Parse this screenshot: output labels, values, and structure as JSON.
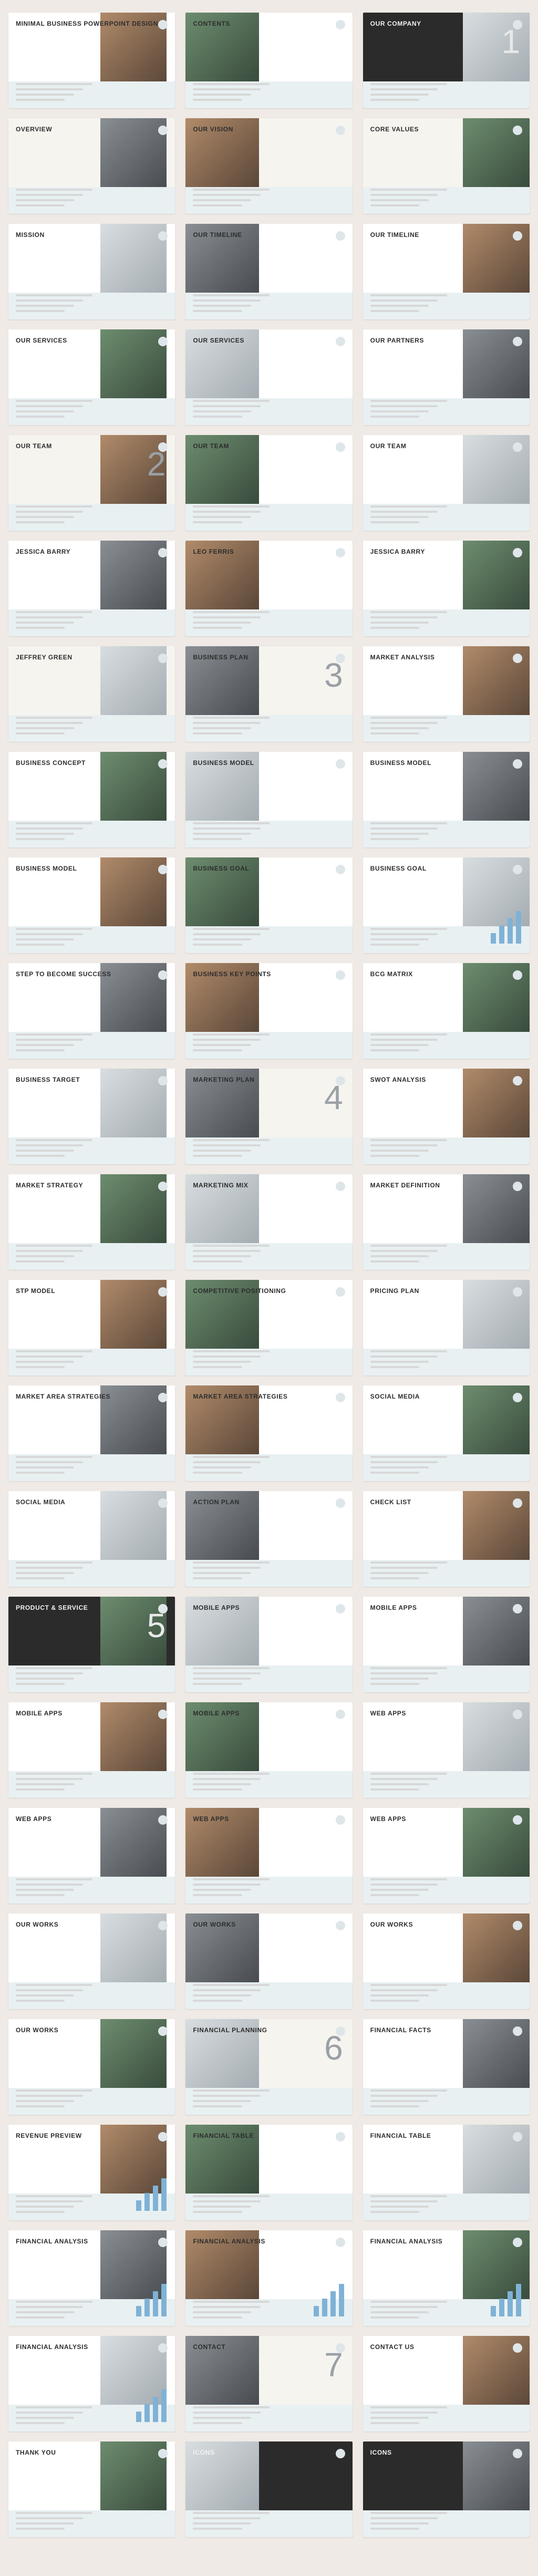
{
  "slides": [
    {
      "title": "MINIMAL BUSINESS POWERPOINT DESIGN",
      "num": "",
      "variant": "cover"
    },
    {
      "title": "CONTENTS",
      "num": "",
      "variant": "contents"
    },
    {
      "title": "OUR COMPANY",
      "num": "1",
      "variant": "company"
    },
    {
      "title": "OVERVIEW",
      "num": "",
      "variant": "overview"
    },
    {
      "title": "OUR VISION",
      "num": "",
      "variant": "vision"
    },
    {
      "title": "CORE VALUES",
      "num": "",
      "variant": "values"
    },
    {
      "title": "MISSION",
      "num": "",
      "variant": "mission"
    },
    {
      "title": "OUR TIMELINE",
      "num": "",
      "variant": "timeline"
    },
    {
      "title": "OUR TIMELINE",
      "num": "",
      "variant": "timeline2"
    },
    {
      "title": "OUR SERVICES",
      "num": "",
      "variant": "services"
    },
    {
      "title": "OUR SERVICES",
      "num": "",
      "variant": "services2"
    },
    {
      "title": "OUR PARTNERS",
      "num": "",
      "variant": "partners"
    },
    {
      "title": "OUR TEAM",
      "num": "2",
      "variant": "team"
    },
    {
      "title": "OUR TEAM",
      "num": "",
      "variant": "team2"
    },
    {
      "title": "OUR TEAM",
      "num": "",
      "variant": "team3"
    },
    {
      "title": "Jessica Barry",
      "num": "",
      "variant": "profile"
    },
    {
      "title": "Leo Ferris",
      "num": "",
      "variant": "profile2"
    },
    {
      "title": "Jessica Barry",
      "num": "",
      "variant": "profile3"
    },
    {
      "title": "Jeffrey Green",
      "num": "",
      "variant": "profile4"
    },
    {
      "title": "BUSINESS PLAN",
      "num": "3",
      "variant": "businessplan"
    },
    {
      "title": "MARKET ANALYSIS",
      "num": "",
      "variant": "market"
    },
    {
      "title": "BUSINESS CONCEPT",
      "num": "",
      "variant": "concept"
    },
    {
      "title": "BUSINESS MODEL",
      "num": "",
      "variant": "model"
    },
    {
      "title": "BUSINESS MODEL",
      "num": "",
      "variant": "model2"
    },
    {
      "title": "BUSINESS MODEL",
      "num": "",
      "variant": "model3"
    },
    {
      "title": "BUSINESS GOAL",
      "num": "",
      "variant": "goal"
    },
    {
      "title": "BUSINESS GOAL",
      "num": "",
      "variant": "goal2"
    },
    {
      "title": "STEP TO BECOME SUCCESS",
      "num": "",
      "variant": "steps"
    },
    {
      "title": "BUSINESS KEY POINTS",
      "num": "",
      "variant": "keypoints"
    },
    {
      "title": "BCG MATRIX",
      "num": "",
      "variant": "bcg"
    },
    {
      "title": "BUSINESS TARGET",
      "num": "",
      "variant": "target"
    },
    {
      "title": "MARKETING PLAN",
      "num": "4",
      "variant": "marketingplan"
    },
    {
      "title": "SWOT ANALYSIS",
      "num": "",
      "variant": "swot"
    },
    {
      "title": "MARKET STRATEGY",
      "num": "",
      "variant": "strategy"
    },
    {
      "title": "MARKETING MIX",
      "num": "",
      "variant": "mix"
    },
    {
      "title": "MARKET DEFINITION",
      "num": "",
      "variant": "definition"
    },
    {
      "title": "STP MODEL",
      "num": "",
      "variant": "stp"
    },
    {
      "title": "COMPETITIVE POSITIONING",
      "num": "",
      "variant": "positioning"
    },
    {
      "title": "PRICING PLAN",
      "num": "",
      "variant": "pricing"
    },
    {
      "title": "MARKET AREA STRATEGIES",
      "num": "",
      "variant": "worldmap"
    },
    {
      "title": "MARKET AREA STRATEGIES",
      "num": "",
      "variant": "usmap"
    },
    {
      "title": "SOCIAL MEDIA",
      "num": "",
      "variant": "social"
    },
    {
      "title": "SOCIAL MEDIA",
      "num": "",
      "variant": "social2"
    },
    {
      "title": "ACTION PLAN",
      "num": "",
      "variant": "action"
    },
    {
      "title": "CHECK LIST",
      "num": "",
      "variant": "checklist"
    },
    {
      "title": "PRODUCT & SERVICE",
      "num": "5",
      "variant": "products"
    },
    {
      "title": "MOBILE APPS",
      "num": "",
      "variant": "mobile"
    },
    {
      "title": "MOBILE APPS",
      "num": "",
      "variant": "mobile2"
    },
    {
      "title": "MOBILE APPS",
      "num": "",
      "variant": "mobile3"
    },
    {
      "title": "MOBILE APPS",
      "num": "",
      "variant": "mobile4"
    },
    {
      "title": "WEB APPS",
      "num": "",
      "variant": "web"
    },
    {
      "title": "WEB APPS",
      "num": "",
      "variant": "web2"
    },
    {
      "title": "WEB APPS",
      "num": "",
      "variant": "web3"
    },
    {
      "title": "WEB APPS",
      "num": "",
      "variant": "web4"
    },
    {
      "title": "OUR WORKS",
      "num": "",
      "variant": "works"
    },
    {
      "title": "OUR WORKS",
      "num": "",
      "variant": "works2"
    },
    {
      "title": "OUR WORKS",
      "num": "",
      "variant": "works3"
    },
    {
      "title": "OUR WORKS",
      "num": "",
      "variant": "works4"
    },
    {
      "title": "FINANCIAL PLANNING",
      "num": "6",
      "variant": "finplan"
    },
    {
      "title": "FINANCIAL FACTS",
      "num": "",
      "variant": "facts"
    },
    {
      "title": "REVENUE PREVIEW",
      "num": "",
      "variant": "revenue"
    },
    {
      "title": "FINANCIAL TABLE",
      "num": "",
      "variant": "fintable"
    },
    {
      "title": "FINANCIAL TABLE",
      "num": "",
      "variant": "fintable2"
    },
    {
      "title": "FINANCIAL ANALYSIS",
      "num": "",
      "variant": "analysis"
    },
    {
      "title": "FINANCIAL ANALYSIS",
      "num": "",
      "variant": "analysis2"
    },
    {
      "title": "FINANCIAL ANALYSIS",
      "num": "",
      "variant": "analysis3"
    },
    {
      "title": "FINANCIAL ANALYSIS",
      "num": "",
      "variant": "analysis4"
    },
    {
      "title": "CONTACT",
      "num": "7",
      "variant": "contact"
    },
    {
      "title": "CONTACT US",
      "num": "",
      "variant": "contactus"
    },
    {
      "title": "THANK YOU",
      "num": "",
      "variant": "thanks"
    },
    {
      "title": "ICONS",
      "num": "",
      "variant": "icons"
    },
    {
      "title": "ICONS",
      "num": "",
      "variant": "icons2"
    }
  ]
}
